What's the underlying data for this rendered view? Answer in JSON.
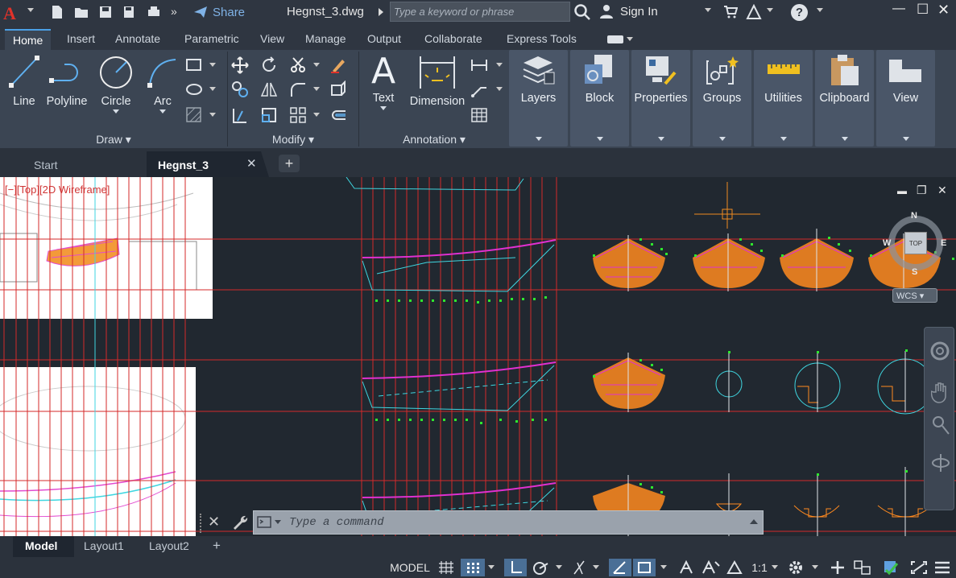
{
  "titlebar": {
    "app_logo": "A",
    "share_label": "Share",
    "document_title": "Hegnst_3.dwg",
    "search_placeholder": "Type a keyword or phrase",
    "signin_label": "Sign In",
    "help_label": "?"
  },
  "ribbon_tabs": [
    {
      "label": "Home",
      "active": true
    },
    {
      "label": "Insert"
    },
    {
      "label": "Annotate"
    },
    {
      "label": "Parametric"
    },
    {
      "label": "View"
    },
    {
      "label": "Manage"
    },
    {
      "label": "Output"
    },
    {
      "label": "Collaborate"
    },
    {
      "label": "Express Tools"
    }
  ],
  "draw_panel": {
    "title": "Draw",
    "line": "Line",
    "polyline": "Polyline",
    "circle": "Circle",
    "arc": "Arc"
  },
  "modify_panel": {
    "title": "Modify"
  },
  "annotation_panel": {
    "title": "Annotation",
    "text": "Text",
    "dimension": "Dimension"
  },
  "tool_panels": [
    "Layers",
    "Block",
    "Properties",
    "Groups",
    "Utilities",
    "Clipboard",
    "View"
  ],
  "file_tabs": {
    "start": "Start",
    "active": "Hegnst_3",
    "close": "✕",
    "add": "+"
  },
  "viewport": {
    "label": "[−][Top][2D Wireframe]",
    "min": "▬",
    "restore": "❐",
    "close": "✕",
    "viewcube": {
      "n": "N",
      "s": "S",
      "e": "E",
      "w": "W",
      "top": "TOP",
      "wcs": "WCS"
    }
  },
  "command": {
    "placeholder": "Type a command"
  },
  "layout_tabs": [
    {
      "label": "Model",
      "active": true
    },
    {
      "label": "Layout1"
    },
    {
      "label": "Layout2"
    }
  ],
  "layout_add": "+",
  "status": {
    "model": "MODEL",
    "scale": "1:1"
  },
  "colors": {
    "accent": "#4ba0e6",
    "grid_red": "#d42a2a",
    "hull_orange": "#ff8a1f",
    "hull_magenta": "#e030d0",
    "cyan": "#3fd6e0",
    "green_point": "#2ee82e"
  }
}
